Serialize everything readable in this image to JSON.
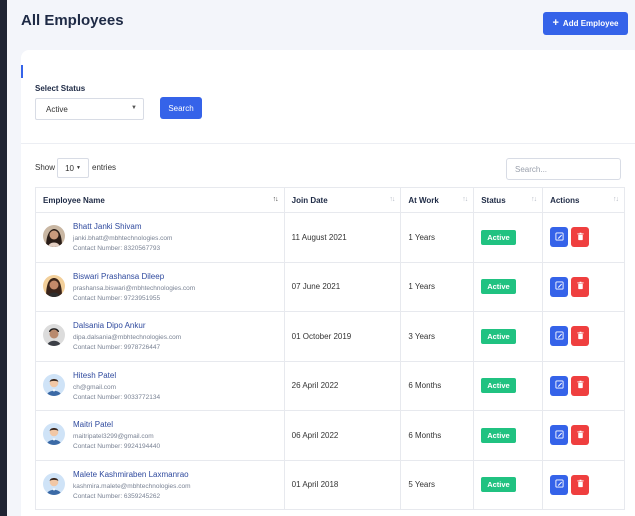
{
  "page": {
    "title": "All Employees"
  },
  "header": {
    "add_button_label": "Add Employee"
  },
  "filter": {
    "label": "Select Status",
    "selected": "Active",
    "search_button": "Search"
  },
  "table_controls": {
    "show_label": "Show",
    "entries_value": "10",
    "entries_label": "entries",
    "search_placeholder": "Search..."
  },
  "columns": [
    "Employee Name",
    "Join Date",
    "At Work",
    "Status",
    "Actions"
  ],
  "rows": [
    {
      "name": "Bhatt Janki Shivam",
      "email": "janki.bhatt@mbhtechnologies.com",
      "contact": "Contact Number: 8320567793",
      "join_date": "11 August 2021",
      "at_work": "1 Years",
      "status": "Active",
      "avatar": "photo-woman-1"
    },
    {
      "name": "Biswari Prashansa Dileep",
      "email": "prashansa.biswari@mbhtechnologies.com",
      "contact": "Contact Number: 9723951955",
      "join_date": "07 June 2021",
      "at_work": "1 Years",
      "status": "Active",
      "avatar": "photo-woman-2"
    },
    {
      "name": "Dalsania Dipo Ankur",
      "email": "dipa.dalsania@mbhtechnologies.com",
      "contact": "Contact Number: 9978726447",
      "join_date": "01 October 2019",
      "at_work": "3 Years",
      "status": "Active",
      "avatar": "photo-man"
    },
    {
      "name": "Hitesh Patel",
      "email": "ch@gmail.com",
      "contact": "Contact Number: 9033772134",
      "join_date": "26 April 2022",
      "at_work": "6 Months",
      "status": "Active",
      "avatar": "default-user"
    },
    {
      "name": "Maitri Patel",
      "email": "maitripatel3299@gmail.com",
      "contact": "Contact Number: 9924194440",
      "join_date": "06 April 2022",
      "at_work": "6 Months",
      "status": "Active",
      "avatar": "default-user"
    },
    {
      "name": "Malete Kashmiraben Laxmanrao",
      "email": "kashmira.malete@mbhtechnologies.com",
      "contact": "Contact Number: 6359245262",
      "join_date": "01 April 2018",
      "at_work": "5 Years",
      "status": "Active",
      "avatar": "default-user"
    }
  ],
  "colors": {
    "primary": "#3563e9",
    "success": "#20c281",
    "danger": "#ef3f3f",
    "title": "#1e2a45",
    "link": "#2f4a9e"
  }
}
